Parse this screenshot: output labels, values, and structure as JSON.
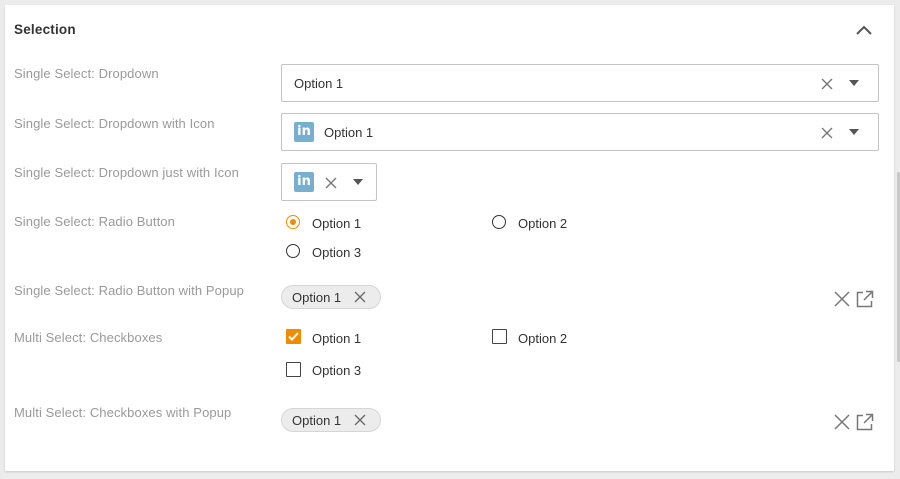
{
  "section": {
    "title": "Selection",
    "collapse_icon": "chevron-up-icon"
  },
  "rows": {
    "dropdown": {
      "label": "Single Select: Dropdown",
      "value": "Option 1"
    },
    "dropdown_with_icon": {
      "label": "Single Select: Dropdown with Icon",
      "value": "Option 1",
      "icon": "linkedin-icon",
      "icon_text": "in"
    },
    "dropdown_just_icon": {
      "label": "Single Select: Dropdown just with Icon",
      "icon": "linkedin-icon",
      "icon_text": "in"
    },
    "radio": {
      "label": "Single Select: Radio Button",
      "options": [
        "Option 1",
        "Option 2",
        "Option 3"
      ],
      "selected": "Option 1"
    },
    "radio_popup": {
      "label": "Single Select: Radio Button with Popup",
      "chip": "Option 1"
    },
    "checkboxes": {
      "label": "Multi Select: Checkboxes",
      "options": [
        "Option 1",
        "Option 2",
        "Option 3"
      ],
      "checked": [
        "Option 1"
      ]
    },
    "checkboxes_popup": {
      "label": "Multi Select: Checkboxes with Popup",
      "chip": "Option 1"
    }
  },
  "colors": {
    "accent": "#f28a00",
    "label": "#9a9a9a",
    "linkedin_badge": "#7aaecd"
  }
}
